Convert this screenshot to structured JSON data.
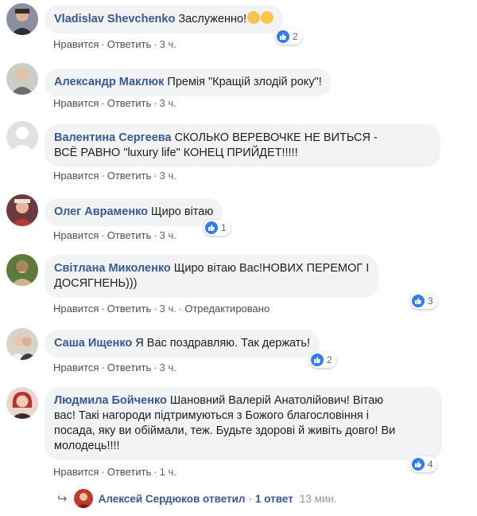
{
  "comments": [
    {
      "author": "Vladislav Shevchenko",
      "text": "Заслуженно!",
      "like": "Нравится",
      "reply": "Ответить",
      "time": "3 ч.",
      "reactions": "2"
    },
    {
      "author": "Александр Маклюк",
      "text": "Премія \"Кращій злодій року\"!",
      "like": "Нравится",
      "reply": "Ответить",
      "time": "3 ч."
    },
    {
      "author": "Валентина Сергеева",
      "text_line1": "СКОЛЬКО ВЕРЕВОЧКЕ НЕ ВИТЬСЯ -",
      "text_line2": "ВСЁ РАВНО \"luxury life\" КОНЕЦ ПРИЙДЕТ!!!!!",
      "like": "Нравится",
      "reply": "Ответить",
      "time": "3 ч."
    },
    {
      "author": "Олег Авраменко",
      "text": "Щиро вітаю",
      "like": "Нравится",
      "reply": "Ответить",
      "time": "3 ч.",
      "reactions": "1"
    },
    {
      "author": "Світлана Миколенко",
      "text_line1": "Щиро вітаю Вас!НОВИХ ПЕРЕМОГ І",
      "text_line2": "ДОСЯГНЕНЬ)))",
      "like": "Нравится",
      "reply": "Ответить",
      "time": "3 ч.",
      "edited": "Отредактировано",
      "reactions": "3"
    },
    {
      "author": "Саша Ищенко",
      "text": "Я Вас поздравляю. Так держать!",
      "like": "Нравится",
      "reply": "Ответить",
      "time": "3 ч.",
      "reactions": "2"
    },
    {
      "author": "Людмила Бойченко",
      "text_line1": "Шановний Валерій Анатолійович! Вітаю",
      "text_line2": "вас! Такі нагороди підтримуються з Божого благословіння і",
      "text_line3": "посада, яку ви обіймали, теж. Будьте здорові й живіть довго! Ви",
      "text_line4": "молодець!!!!",
      "like": "Нравится",
      "reply": "Ответить",
      "time": "1 ч.",
      "reactions": "4"
    }
  ],
  "reply_thread": {
    "author": "Алексей Сердюков",
    "replied": "ответил",
    "count": "1 ответ",
    "time": "13 мин."
  },
  "colors": {
    "author": "#385898",
    "bubble": "#f2f3f5",
    "like_blue": "#2d7cf6",
    "meta": "#606770"
  },
  "icons": [
    "like-icon",
    "clapping-hands-emoji",
    "grinning-emoji",
    "reply-arrow-icon"
  ]
}
